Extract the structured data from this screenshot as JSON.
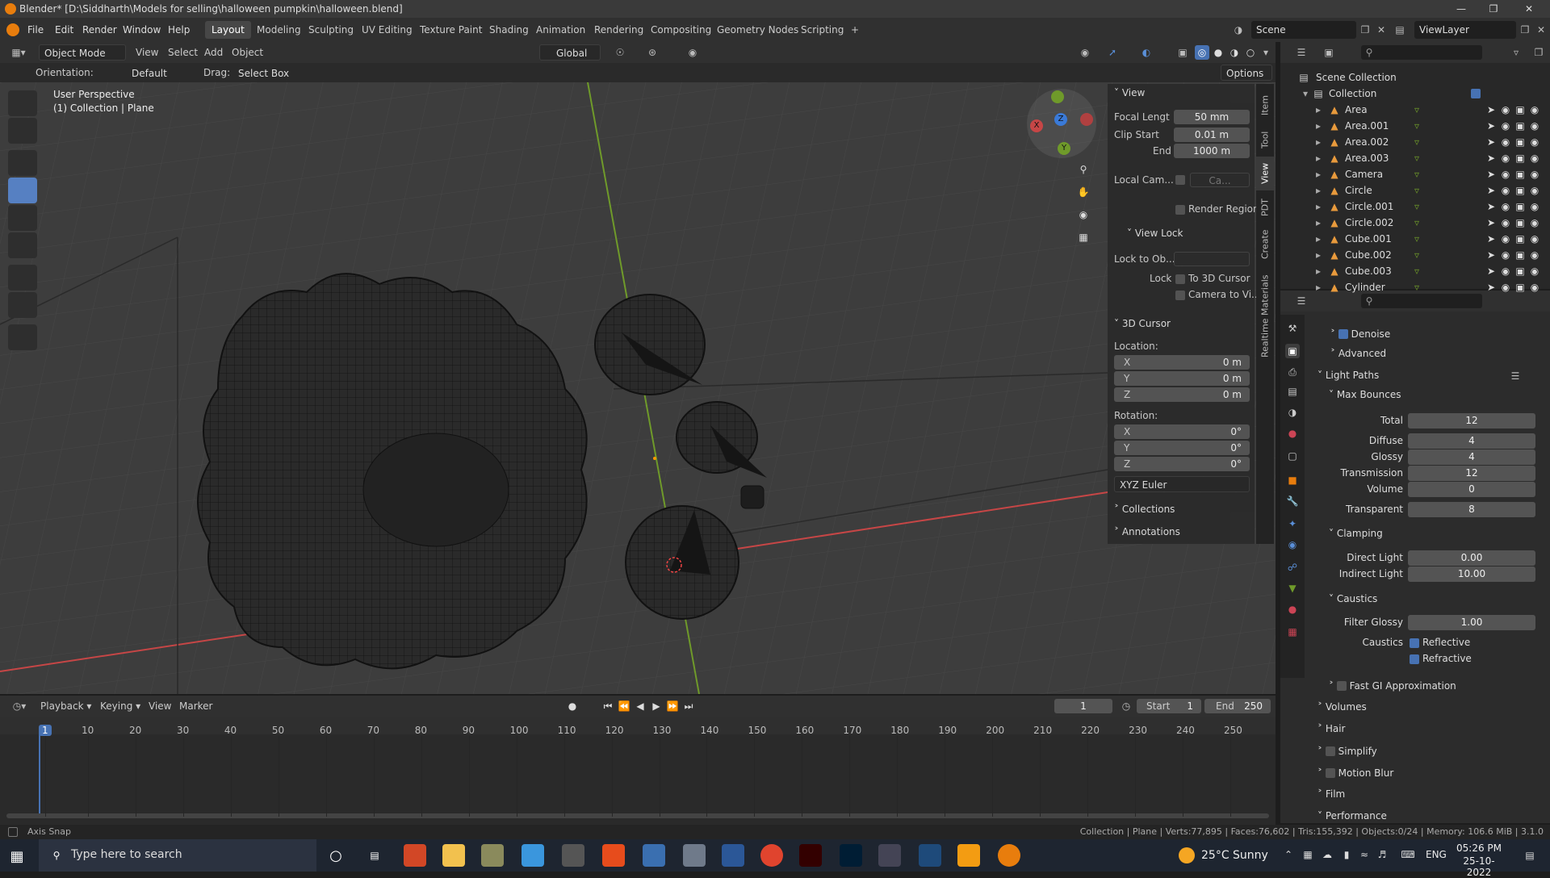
{
  "title_bar": {
    "text": "Blender* [D:\\Siddharth\\Models for selling\\halloween pumpkin\\halloween.blend]"
  },
  "menu": {
    "items": [
      "File",
      "Edit",
      "Render",
      "Window",
      "Help"
    ]
  },
  "workspaces": [
    "Layout",
    "Modeling",
    "Sculpting",
    "UV Editing",
    "Texture Paint",
    "Shading",
    "Animation",
    "Rendering",
    "Compositing",
    "Geometry Nodes",
    "Scripting",
    "+"
  ],
  "scene": {
    "scene_name": "Scene",
    "view_layer": "ViewLayer"
  },
  "header3d": {
    "mode": "Object Mode",
    "view": "View",
    "select": "Select",
    "add": "Add",
    "object": "Object",
    "transform": "Global",
    "options": "Options"
  },
  "toolsettings": {
    "orientation_label": "Orientation:",
    "orientation_value": "Default",
    "drag_label": "Drag:",
    "drag_value": "Select Box"
  },
  "viewport": {
    "overlay_line1": "User Perspective",
    "overlay_line2": "(1) Collection | Plane"
  },
  "npanel": {
    "view_title": "View",
    "focal_label": "Focal Lengt",
    "focal_value": "50 mm",
    "clip_start_label": "Clip Start",
    "clip_start_value": "0.01 m",
    "end_label": "End",
    "end_value": "1000 m",
    "local_cam_label": "Local Cam...",
    "local_cam_value": "Ca...",
    "render_region": "Render Region",
    "view_lock_title": "View Lock",
    "lock_to_obj_label": "Lock to Ob...",
    "lock_label": "Lock",
    "to_3d_cursor": "To 3D Cursor",
    "camera_to_view": "Camera to Vi...",
    "cursor_title": "3D Cursor",
    "location_label": "Location:",
    "loc_x": "X",
    "loc_x_val": "0 m",
    "loc_y": "Y",
    "loc_y_val": "0 m",
    "loc_z": "Z",
    "loc_z_val": "0 m",
    "rotation_label": "Rotation:",
    "rot_x": "X",
    "rot_x_val": "0°",
    "rot_y": "Y",
    "rot_y_val": "0°",
    "rot_z": "Z",
    "rot_z_val": "0°",
    "rot_mode": "XYZ Euler",
    "collections": "Collections",
    "annotations": "Annotations"
  },
  "vtabs": [
    "Item",
    "Tool",
    "View",
    "PDT",
    "Create",
    "Realtime Materials"
  ],
  "outliner": {
    "root": "Scene Collection",
    "collection": "Collection",
    "items": [
      "Area",
      "Area.001",
      "Area.002",
      "Area.003",
      "Camera",
      "Circle",
      "Circle.001",
      "Circle.002",
      "Cube.001",
      "Cube.002",
      "Cube.003",
      "Cylinder"
    ]
  },
  "properties": {
    "denoise": "Denoise",
    "advanced": "Advanced",
    "light_paths": "Light Paths",
    "max_bounces": "Max Bounces",
    "total_label": "Total",
    "total_val": "12",
    "diffuse_label": "Diffuse",
    "diffuse_val": "4",
    "glossy_label": "Glossy",
    "glossy_val": "4",
    "transmission_label": "Transmission",
    "transmission_val": "12",
    "volume_label": "Volume",
    "volume_val": "0",
    "transparent_label": "Transparent",
    "transparent_val": "8",
    "clamping": "Clamping",
    "direct_label": "Direct Light",
    "direct_val": "0.00",
    "indirect_label": "Indirect Light",
    "indirect_val": "10.00",
    "caustics_title": "Caustics",
    "filter_glossy_label": "Filter Glossy",
    "filter_glossy_val": "1.00",
    "caustics_label": "Caustics",
    "reflective": "Reflective",
    "refractive": "Refractive",
    "fast_gi": "Fast GI Approximation",
    "volumes": "Volumes",
    "hair": "Hair",
    "simplify": "Simplify",
    "motion_blur": "Motion Blur",
    "film": "Film",
    "performance": "Performance"
  },
  "timeline": {
    "playback": "Playback",
    "keying": "Keying",
    "view": "View",
    "marker": "Marker",
    "current_frame": "1",
    "start_label": "Start",
    "start_val": "1",
    "end_label": "End",
    "end_val": "250",
    "ticks": [
      "1",
      "10",
      "20",
      "30",
      "40",
      "50",
      "60",
      "70",
      "80",
      "90",
      "100",
      "110",
      "120",
      "130",
      "140",
      "150",
      "160",
      "170",
      "180",
      "190",
      "200",
      "210",
      "220",
      "230",
      "240",
      "250"
    ]
  },
  "statusbar": {
    "left": "Axis Snap",
    "right": "Collection | Plane | Verts:77,895 | Faces:76,602 | Tris:155,392 | Objects:0/24 | Memory: 106.6 MiB | 3.1.0"
  },
  "taskbar": {
    "search_placeholder": "Type here to search",
    "weather": "25°C  Sunny",
    "lang": "ENG",
    "time": "05:26 PM",
    "date": "25-10-2022"
  },
  "colors": {
    "accent": "#4772b3",
    "active_tool": "#5680c2",
    "viewport_bg": "#3c3c3c",
    "x_axis": "#c64646",
    "y_axis": "#6f9a2a",
    "z_axis": "#3a7ad8"
  }
}
